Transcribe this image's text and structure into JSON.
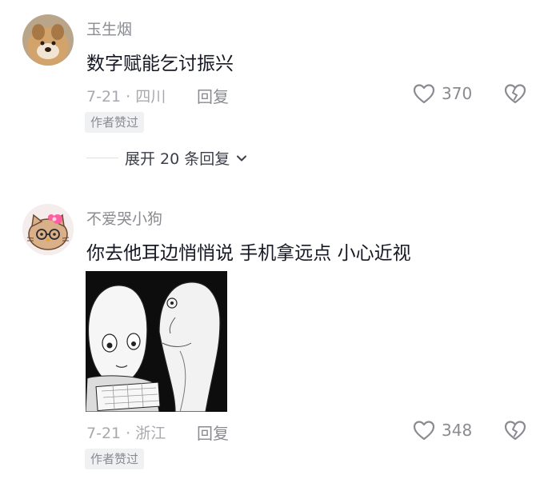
{
  "comments": [
    {
      "username": "玉生烟",
      "text": "数字赋能乞讨振兴",
      "date_location": "7-21 · 四川",
      "reply_label": "回复",
      "likes": "370",
      "badge": "作者赞过",
      "avatar_icon": "dog-avatar-icon"
    },
    {
      "username": "不爱哭小狗",
      "text": "你去他耳边悄悄说 手机拿远点 小心近视",
      "date_location": "7-21 · 浙江",
      "reply_label": "回复",
      "likes": "348",
      "badge": "作者赞过",
      "avatar_icon": "hello-kitty-avatar-icon"
    }
  ],
  "expand_replies": "展开 20 条回复",
  "icons": {
    "like": "heart-outline-icon",
    "dislike": "broken-heart-icon",
    "expand": "chevron-down-icon"
  },
  "colors": {
    "primary_text": "#161823",
    "secondary_text": "#8a8b91",
    "badge_bg": "#f0f1f3"
  }
}
